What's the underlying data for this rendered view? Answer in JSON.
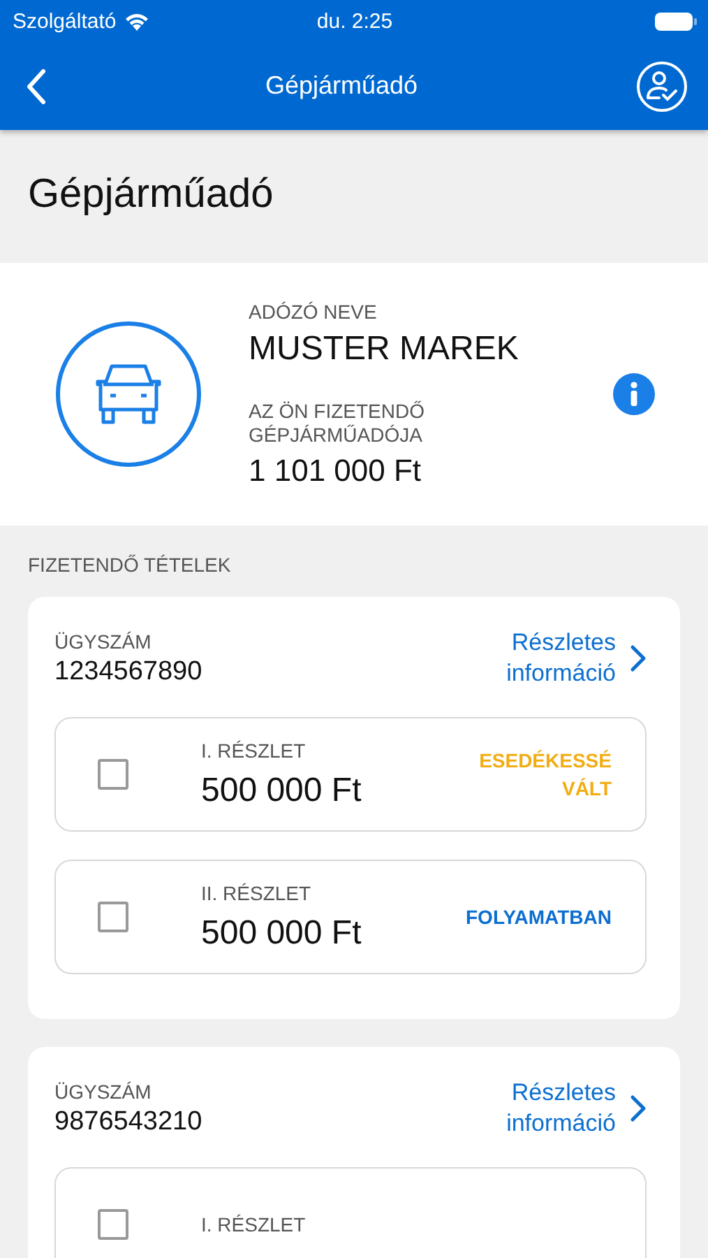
{
  "status_bar": {
    "carrier": "Szolgáltató",
    "time": "du. 2:25"
  },
  "nav_bar": {
    "title": "Gépjárműadó"
  },
  "page_title": "Gépjárműadó",
  "taxpayer": {
    "name_label": "ADÓZÓ NEVE",
    "name": "MUSTER MAREK",
    "amount_label": "AZ ÖN FIZETENDŐ GÉPJÁRMŰADÓJA",
    "amount": "1 101 000 Ft"
  },
  "section_title": "FIZETENDŐ TÉTELEK",
  "cases": [
    {
      "case_label": "ÜGYSZÁM",
      "case_number": "1234567890",
      "details_link": "Részletes információ",
      "installments": [
        {
          "label": "I. RÉSZLET",
          "amount": "500 000 Ft",
          "status": "ESEDÉKESSÉ VÁLT",
          "kind": "due",
          "checked": false
        },
        {
          "label": "II. RÉSZLET",
          "amount": "500 000 Ft",
          "status": "FOLYAMATBAN",
          "kind": "progress",
          "checked": false
        }
      ]
    },
    {
      "case_label": "ÜGYSZÁM",
      "case_number": "9876543210",
      "details_link": "Részletes információ",
      "installments": [
        {
          "label": "I. RÉSZLET",
          "checked": false
        }
      ]
    }
  ]
}
